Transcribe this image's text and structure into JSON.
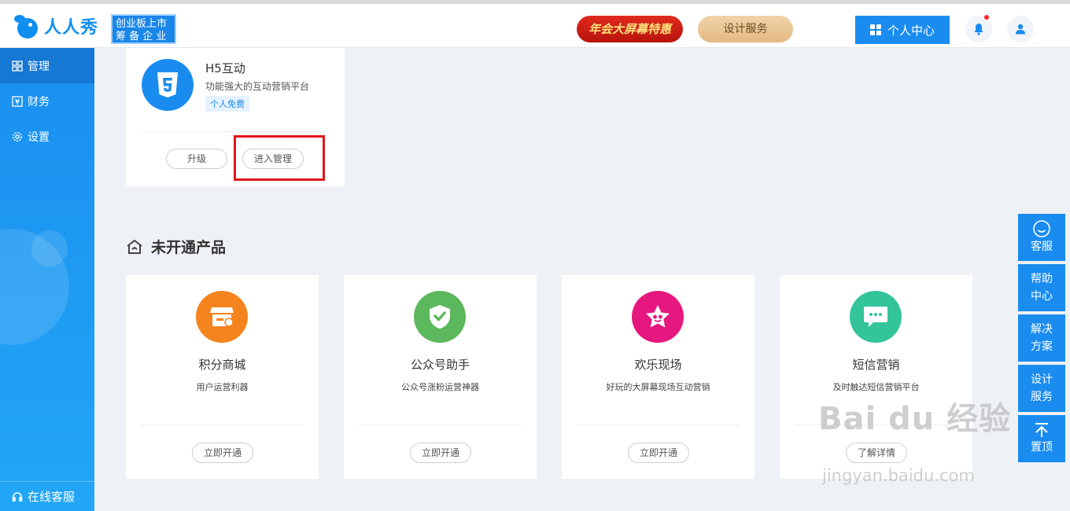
{
  "header": {
    "logo_text": "人人秀",
    "ipo_badge": [
      "创业板上市",
      "筹 备 企 业"
    ],
    "promo_red": "年会大屏幕特惠",
    "promo_gold": "设计服务",
    "personal_center": "个人中心"
  },
  "sidebar": {
    "items": [
      {
        "label": "管理",
        "icon": "grid-icon"
      },
      {
        "label": "财务",
        "icon": "finance-icon"
      },
      {
        "label": "设置",
        "icon": "gear-icon"
      }
    ],
    "footer": "在线客服"
  },
  "h5_card": {
    "title": "H5互动",
    "desc": "功能强大的互动营销平台",
    "tag": "个人免费",
    "upgrade": "升级",
    "manage": "进入管理"
  },
  "section_title": "未开通产品",
  "tiles": [
    {
      "name": "积分商城",
      "desc": "用户运营利器",
      "button": "立即开通",
      "color": "#f5841f"
    },
    {
      "name": "公众号助手",
      "desc": "公众号涨粉运营神器",
      "button": "立即开通",
      "color": "#5cb85c"
    },
    {
      "name": "欢乐现场",
      "desc": "好玩的大屏幕现场互动营销",
      "button": "立即开通",
      "color": "#e6177f"
    },
    {
      "name": "短信营销",
      "desc": "及时触达短信营销平台",
      "button": "了解详情",
      "color": "#33c49a"
    }
  ],
  "float_menu": [
    {
      "label": "客服"
    },
    {
      "label": [
        "帮助",
        "中心"
      ]
    },
    {
      "label": [
        "解决",
        "方案"
      ]
    },
    {
      "label": [
        "设计",
        "服务"
      ]
    },
    {
      "label": "置顶"
    }
  ],
  "watermark": {
    "main": "Bai du 经验",
    "sub": "jingyan.baidu.com"
  }
}
